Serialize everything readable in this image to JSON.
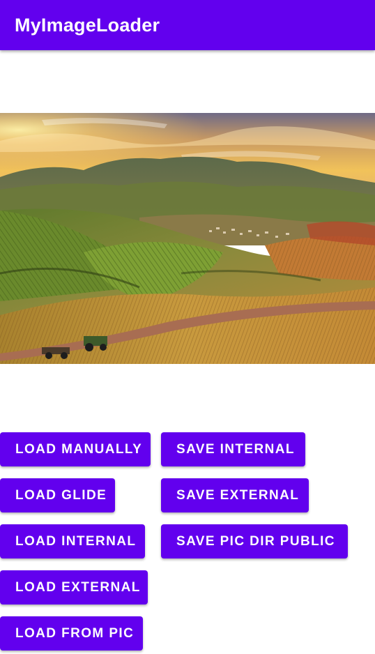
{
  "app_bar": {
    "title": "MyImageLoader",
    "color": "#6200EE"
  },
  "image_view": {
    "description": "scenic-landscape-photo"
  },
  "buttons": {
    "load_manually": "LOAD MANUALLY",
    "load_glide": "LOAD GLIDE",
    "load_internal": "LOAD INTERNAL",
    "load_external": "LOAD EXTERNAL",
    "load_from_pic": "LOAD FROM PIC",
    "save_internal": "SAVE INTERNAL",
    "save_external": "SAVE EXTERNAL",
    "save_pic_dir_public": "SAVE PIC DIR PUBLIC"
  },
  "colors": {
    "primary": "#6200EE",
    "on_primary": "#FFFFFF",
    "background": "#FFFFFF"
  }
}
